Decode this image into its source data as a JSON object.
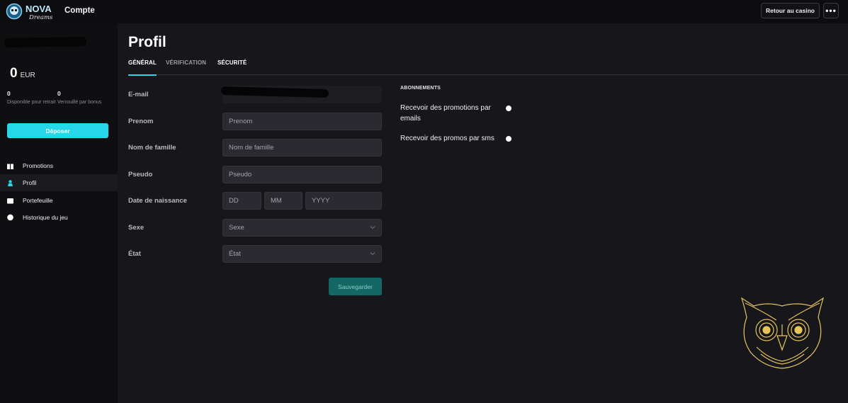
{
  "header": {
    "logo_text": "NOVA",
    "logo_subtext": "Dreams",
    "title": "Compte",
    "return_label": "Retour au casino",
    "more_label": "•••"
  },
  "sidebar": {
    "balance_amount": "0",
    "balance_currency": "EUR",
    "withdrawable_value": "0",
    "withdrawable_label": "Disponible pour retrait",
    "locked_value": "0",
    "locked_label": "Verrouillé par bonus",
    "deposit_label": "Déposer",
    "nav": [
      {
        "label": "Promotions",
        "icon": "gift-icon"
      },
      {
        "label": "Profil",
        "icon": "user-icon"
      },
      {
        "label": "Portefeuille",
        "icon": "wallet-icon"
      },
      {
        "label": "Historique du jeu",
        "icon": "history-icon"
      }
    ],
    "active_index": 1
  },
  "main": {
    "title": "Profil",
    "tabs": [
      {
        "label": "GÉNÉRAL",
        "active": true
      },
      {
        "label": "VÉRIFICATION",
        "active": false
      },
      {
        "label": "SÉCURITÉ",
        "active": false
      }
    ],
    "form": {
      "email_label": "E-mail",
      "firstname_label": "Prenom",
      "firstname_placeholder": "Prenom",
      "lastname_label": "Nom de famille",
      "lastname_placeholder": "Nom de famille",
      "nickname_label": "Pseudo",
      "nickname_placeholder": "Pseudo",
      "birthdate_label": "Date de naissance",
      "day_placeholder": "DD",
      "month_placeholder": "MM",
      "year_placeholder": "YYYY",
      "gender_label": "Sexe",
      "gender_value": "Sexe",
      "state_label": "État",
      "state_value": "État",
      "save_label": "Sauvegarder"
    },
    "subscriptions": {
      "title": "ABONNEMENTS",
      "items": [
        {
          "label": "Recevoir des promotions par emails"
        },
        {
          "label": "Recevoir des promos par sms"
        }
      ]
    }
  },
  "colors": {
    "accent": "#25d7e8",
    "save_button": "#136866",
    "owl_gold": "#e6c45a"
  }
}
